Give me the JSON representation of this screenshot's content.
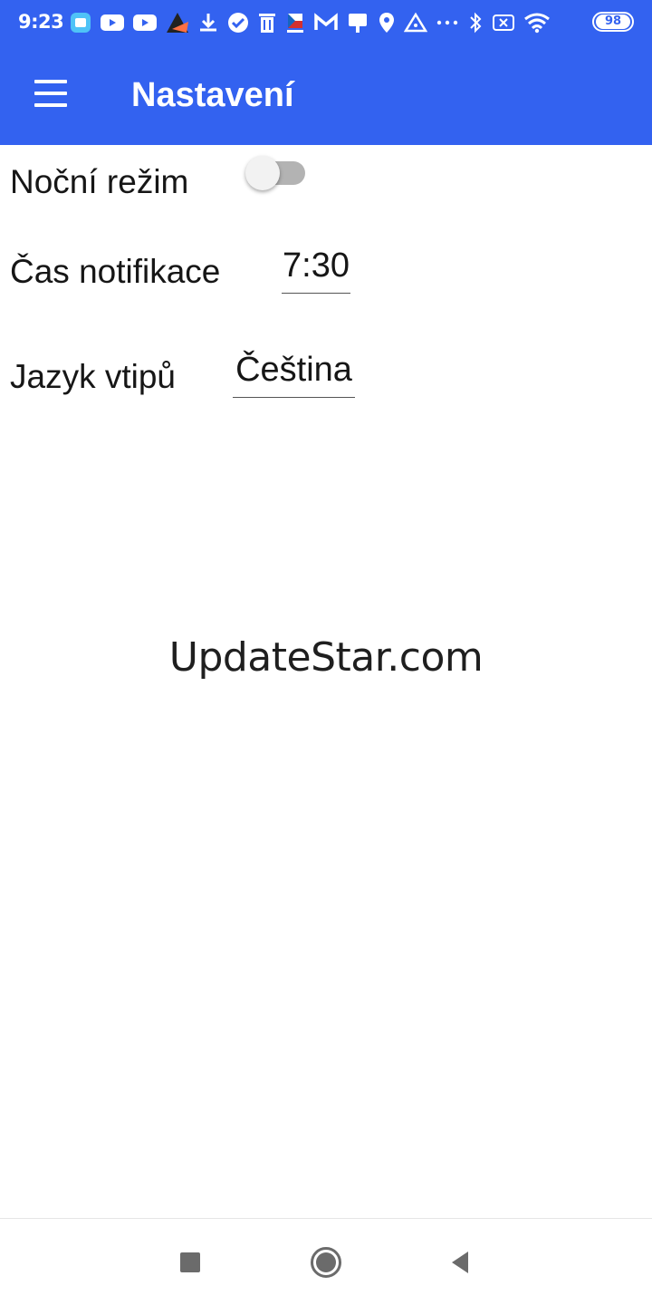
{
  "status_bar": {
    "time": "9:23",
    "battery": "98",
    "icons": [
      "app-icon",
      "youtube-icon",
      "youtube-icon",
      "app-icon",
      "download-icon",
      "check-icon",
      "trash-icon",
      "flag-icon",
      "gmail-icon",
      "sign-icon",
      "location-icon",
      "warning-icon",
      "more-icon",
      "bluetooth-icon",
      "sim-off-icon",
      "wifi-icon"
    ]
  },
  "header": {
    "title": "Nastavení",
    "background": "#3362f0"
  },
  "settings": {
    "night_mode_label": "Noční režim",
    "night_mode_on": false,
    "notification_time_label": "Čas notifikace",
    "notification_time_value": "7:30",
    "joke_language_label": "Jazyk vtipů",
    "joke_language_value": "Čeština"
  },
  "watermark": "UpdateStar.com",
  "nav_bar": {
    "buttons": [
      "recents-icon",
      "home-icon",
      "back-icon"
    ]
  }
}
